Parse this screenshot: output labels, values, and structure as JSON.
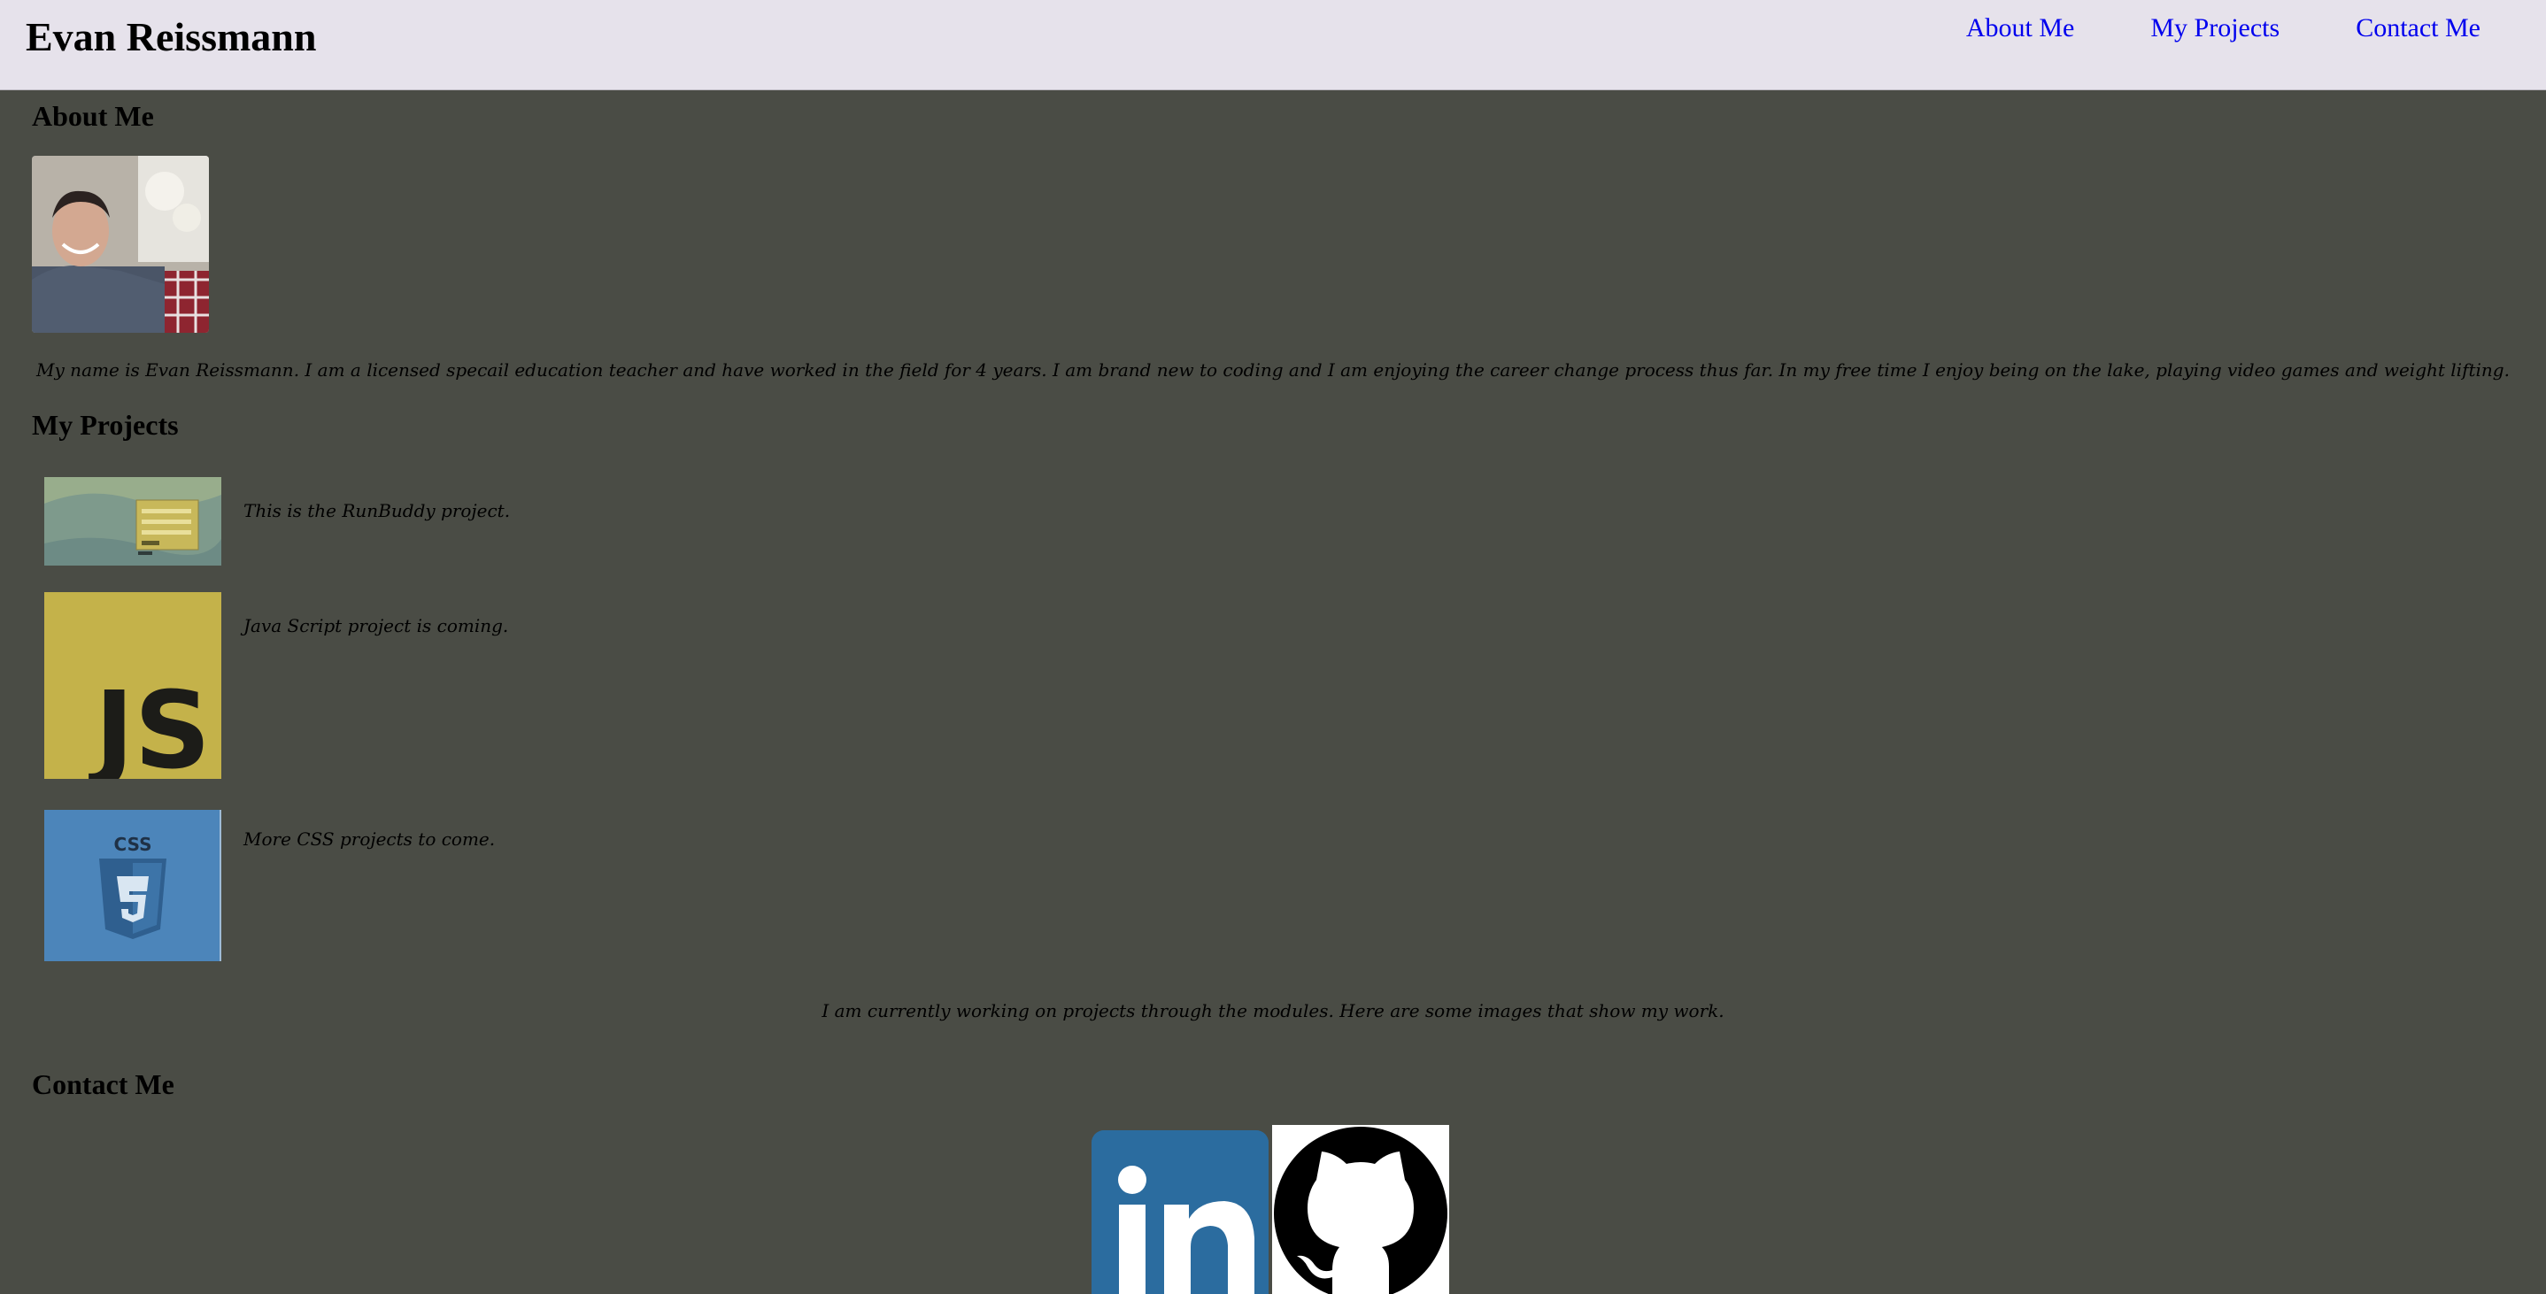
{
  "header": {
    "title": "Evan Reissmann",
    "nav": [
      {
        "label": "About Me"
      },
      {
        "label": "My Projects"
      },
      {
        "label": "Contact Me"
      }
    ]
  },
  "about": {
    "heading": "About Me",
    "bio": "My name is Evan Reissmann. I am a licensed specail education teacher and have worked in the field for 4 years. I am brand new to coding and I am enjoying the career change process thus far. In my free time I enjoy being on the lake, playing video games and weight lifting."
  },
  "projects": {
    "heading": "My Projects",
    "items": [
      {
        "caption": "This is the RunBuddy project."
      },
      {
        "caption": "Java Script project is coming."
      },
      {
        "caption": "More CSS projects to come."
      }
    ],
    "summary": "I am currently working on projects through the modules. Here are some images that show my work."
  },
  "contact": {
    "heading": "Contact Me"
  },
  "colors": {
    "header_bg": "#e6e2eb",
    "page_bg": "#4a4c45",
    "link": "#0000ee",
    "linkedin_blue": "#2b6c9f",
    "js_yellow": "#c4b24a",
    "css_blue": "#4c85ba"
  }
}
